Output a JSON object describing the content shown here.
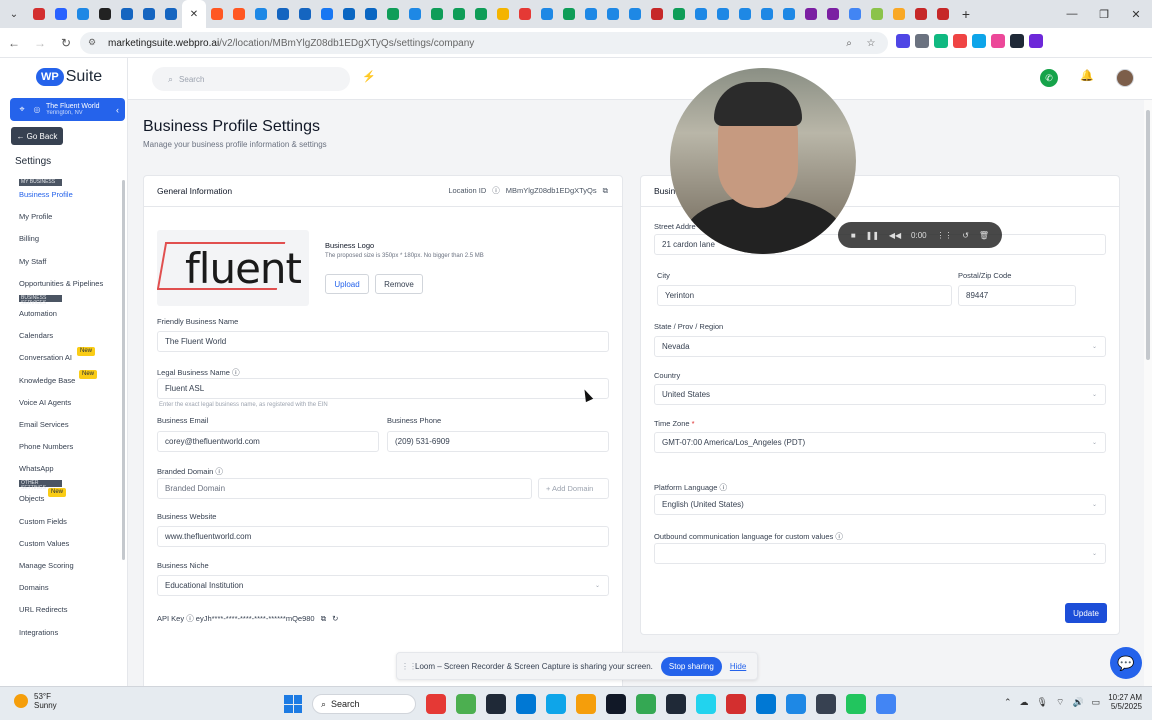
{
  "browser": {
    "url_host": "marketingsuite.webpro.ai",
    "url_path": "/v2/location/MBmYlgZ08db1EDgXTyQs/settings/company",
    "tab_colors": [
      "#d32f2f",
      "#2962ff",
      "#1e88e5",
      "#222222",
      "#1565c0",
      "#1565c0",
      "#1565c0",
      "#222222",
      "#ff5722",
      "#ff5722",
      "#1e88e5",
      "#1565c0",
      "#1565c0",
      "#1877f2",
      "#0a66c2",
      "#0a66c2",
      "#0f9d58",
      "#1e88e5",
      "#0f9d58",
      "#0f9d58",
      "#0f9d58",
      "#f4b400",
      "#e53935",
      "#1e88e5",
      "#0f9d58",
      "#1e88e5",
      "#1e88e5",
      "#1e88e5",
      "#c62828",
      "#0f9d58",
      "#1e88e5",
      "#1e88e5",
      "#1e88e5",
      "#1e88e5",
      "#1e88e5",
      "#7b1fa2",
      "#7b1fa2",
      "#4285f4",
      "#8bc34a",
      "#f9a825",
      "#c62828",
      "#c62828"
    ],
    "ext_colors": [
      "#4f46e5",
      "#6b7280",
      "#10b981",
      "#ef4444",
      "#0ea5e9",
      "#ec4899",
      "#1f2937",
      "#6d28d9"
    ]
  },
  "sidebar": {
    "brand_wp": "WP",
    "brand_suite": "Suite",
    "location_name": "The Fluent World",
    "location_sub": "Yerington, NV",
    "go_back": "Go Back",
    "settings_title": "Settings",
    "sections": {
      "my_business": "MY BUSINESS",
      "business_services": "BUSINESS SERVICES",
      "other_settings": "OTHER SETTINGS"
    },
    "items_business": [
      "Business Profile",
      "My Profile",
      "Billing",
      "My Staff",
      "Opportunities & Pipelines"
    ],
    "items_services": [
      "Automation",
      "Calendars",
      "Conversation AI",
      "Knowledge Base",
      "Voice AI Agents",
      "Email Services",
      "Phone Numbers",
      "WhatsApp"
    ],
    "items_other": [
      "Objects",
      "Custom Fields",
      "Custom Values",
      "Manage Scoring",
      "Domains",
      "URL Redirects",
      "Integrations"
    ],
    "badge_new": "New"
  },
  "topbar": {
    "search_placeholder": "Search"
  },
  "page": {
    "title": "Business Profile Settings",
    "subtitle": "Manage your business profile information & settings"
  },
  "general": {
    "header": "General Information",
    "location_id_label": "Location ID",
    "location_id": "MBmYlgZ08db1EDgXTyQs",
    "logo_word": "fluent",
    "logo_title": "Business Logo",
    "logo_help": "The proposed size is 350px * 180px. No bigger than 2.5 MB",
    "upload": "Upload",
    "remove": "Remove",
    "friendly_label": "Friendly Business Name",
    "friendly_value": "The Fluent World",
    "legal_label": "Legal Business Name",
    "legal_value": "Fluent ASL",
    "legal_hint": "Enter the exact legal business name, as registered with the EIN",
    "email_label": "Business Email",
    "email_value": "corey@thefluentworld.com",
    "phone_label": "Business Phone",
    "phone_value": "(209) 531-6909",
    "domain_label": "Branded Domain",
    "domain_placeholder": "Branded Domain",
    "add_domain": "+ Add Domain",
    "website_label": "Business Website",
    "website_value": "www.thefluentworld.com",
    "niche_label": "Business Niche",
    "niche_value": "Educational Institution",
    "api_key_label": "API Key",
    "api_key_value": "eyJh****-****-****-****-******mQe980"
  },
  "address": {
    "header": "Busin",
    "street_label": "Street Addre",
    "street_value": "21 cardon lane",
    "city_label": "City",
    "city_value": "Yerinton",
    "zip_label": "Postal/Zip Code",
    "zip_value": "89447",
    "state_label": "State / Prov / Region",
    "state_value": "Nevada",
    "country_label": "Country",
    "country_value": "United States",
    "tz_label": "Time Zone",
    "tz_value": "GMT-07:00 America/Los_Angeles (PDT)",
    "lang_label": "Platform Language",
    "lang_value": "English (United States)",
    "outbound_label": "Outbound communication language for custom values",
    "update": "Update"
  },
  "camera": {
    "timer": "0:00"
  },
  "loom": {
    "message": "Loom – Screen Recorder & Screen Capture is sharing your screen.",
    "stop": "Stop sharing",
    "hide": "Hide"
  },
  "taskbar": {
    "temp": "53°F",
    "weather": "Sunny",
    "search": "Search",
    "time": "10:27 AM",
    "date": "5/5/2025",
    "app_colors": [
      "#e53935",
      "#4caf50",
      "#1f2937",
      "#0078d4",
      "#0ea5e9",
      "#f59e0b",
      "#111827",
      "#34a853",
      "#1f2937",
      "#22d3ee",
      "#d32f2f",
      "#0078d4",
      "#1e88e5",
      "#374151",
      "#22c55e",
      "#4285f4"
    ]
  }
}
